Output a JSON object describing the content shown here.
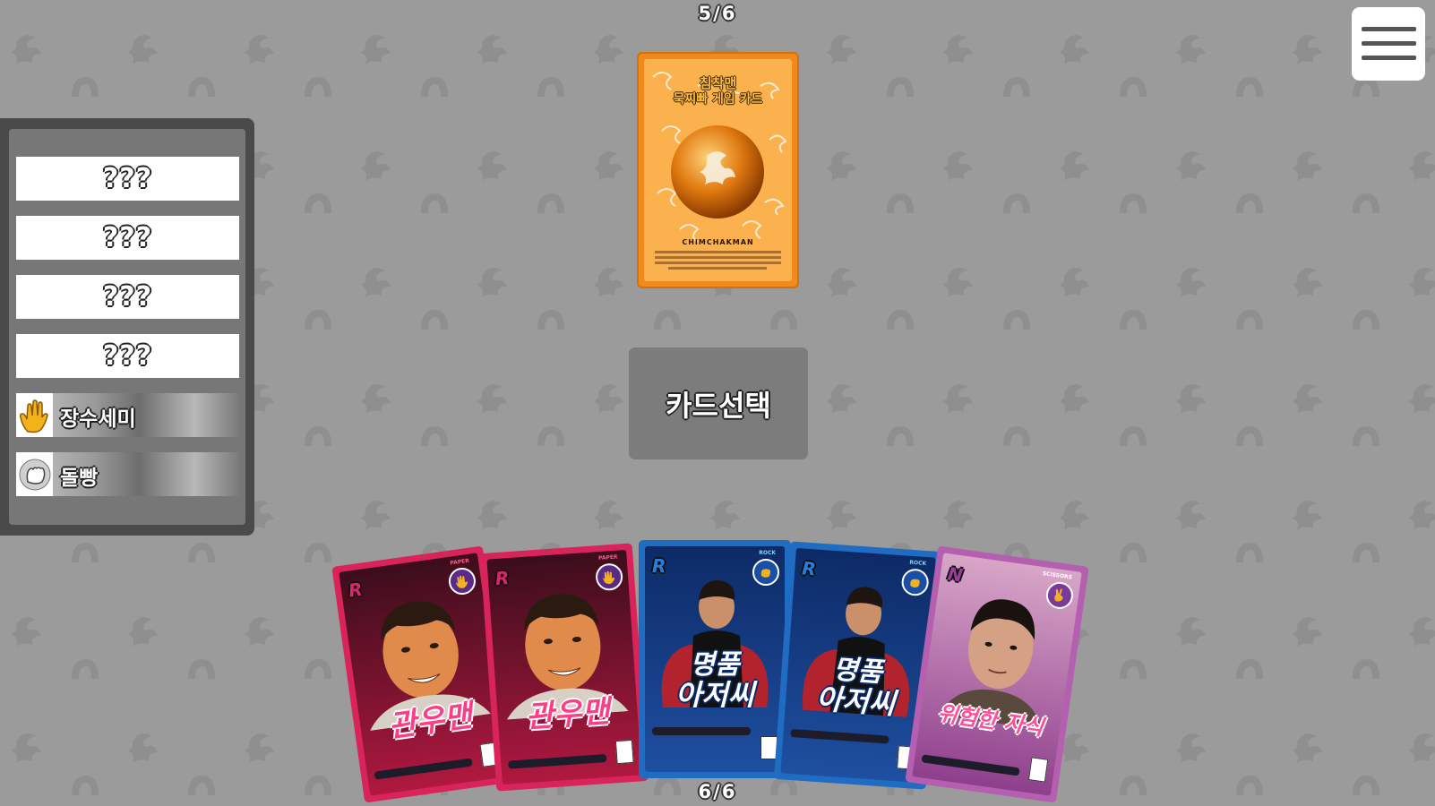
{
  "round_counter_top": "5/6",
  "round_counter_bottom": "6/6",
  "menu": {
    "icon": "hamburger-menu-icon"
  },
  "player_panel": {
    "hidden_slots": [
      "???",
      "???",
      "???",
      "???"
    ],
    "players": [
      {
        "name": "장수세미",
        "hand_icon": "paper-hand-icon",
        "hand_color": "#f2b21b"
      },
      {
        "name": "돌빵",
        "hand_icon": "rock-fist-icon",
        "hand_color": "#9a9a9a"
      }
    ]
  },
  "deck_card": {
    "title_line1": "침착맨",
    "title_line2": "묵찌빠 게임 카드",
    "brand": "CHIMCHAKMAN"
  },
  "select_button": {
    "label": "카드선택"
  },
  "hand_cards": [
    {
      "rarity": "R",
      "type": "PAPER",
      "hand_icon": "paper-hand-icon",
      "name": "관우맨",
      "theme": "pink"
    },
    {
      "rarity": "R",
      "type": "PAPER",
      "hand_icon": "paper-hand-icon",
      "name": "관우맨",
      "theme": "pink"
    },
    {
      "rarity": "R",
      "type": "ROCK",
      "hand_icon": "rock-fist-icon",
      "name_line1": "명품",
      "name_line2": "아저씨",
      "theme": "blue"
    },
    {
      "rarity": "R",
      "type": "ROCK",
      "hand_icon": "rock-fist-icon",
      "name_line1": "명품",
      "name_line2": "아저씨",
      "theme": "blue"
    },
    {
      "rarity": "N",
      "type": "SCISSORS",
      "hand_icon": "scissors-hand-icon",
      "name": "위험한 자식",
      "theme": "purple"
    }
  ],
  "colors": {
    "background": "#9b9b9b",
    "panel": "#4a4a4a",
    "deck_orange": "#f08a1c",
    "card_pink": "#d8245a",
    "card_blue": "#1f6cc2",
    "card_purple": "#b55fb0"
  }
}
